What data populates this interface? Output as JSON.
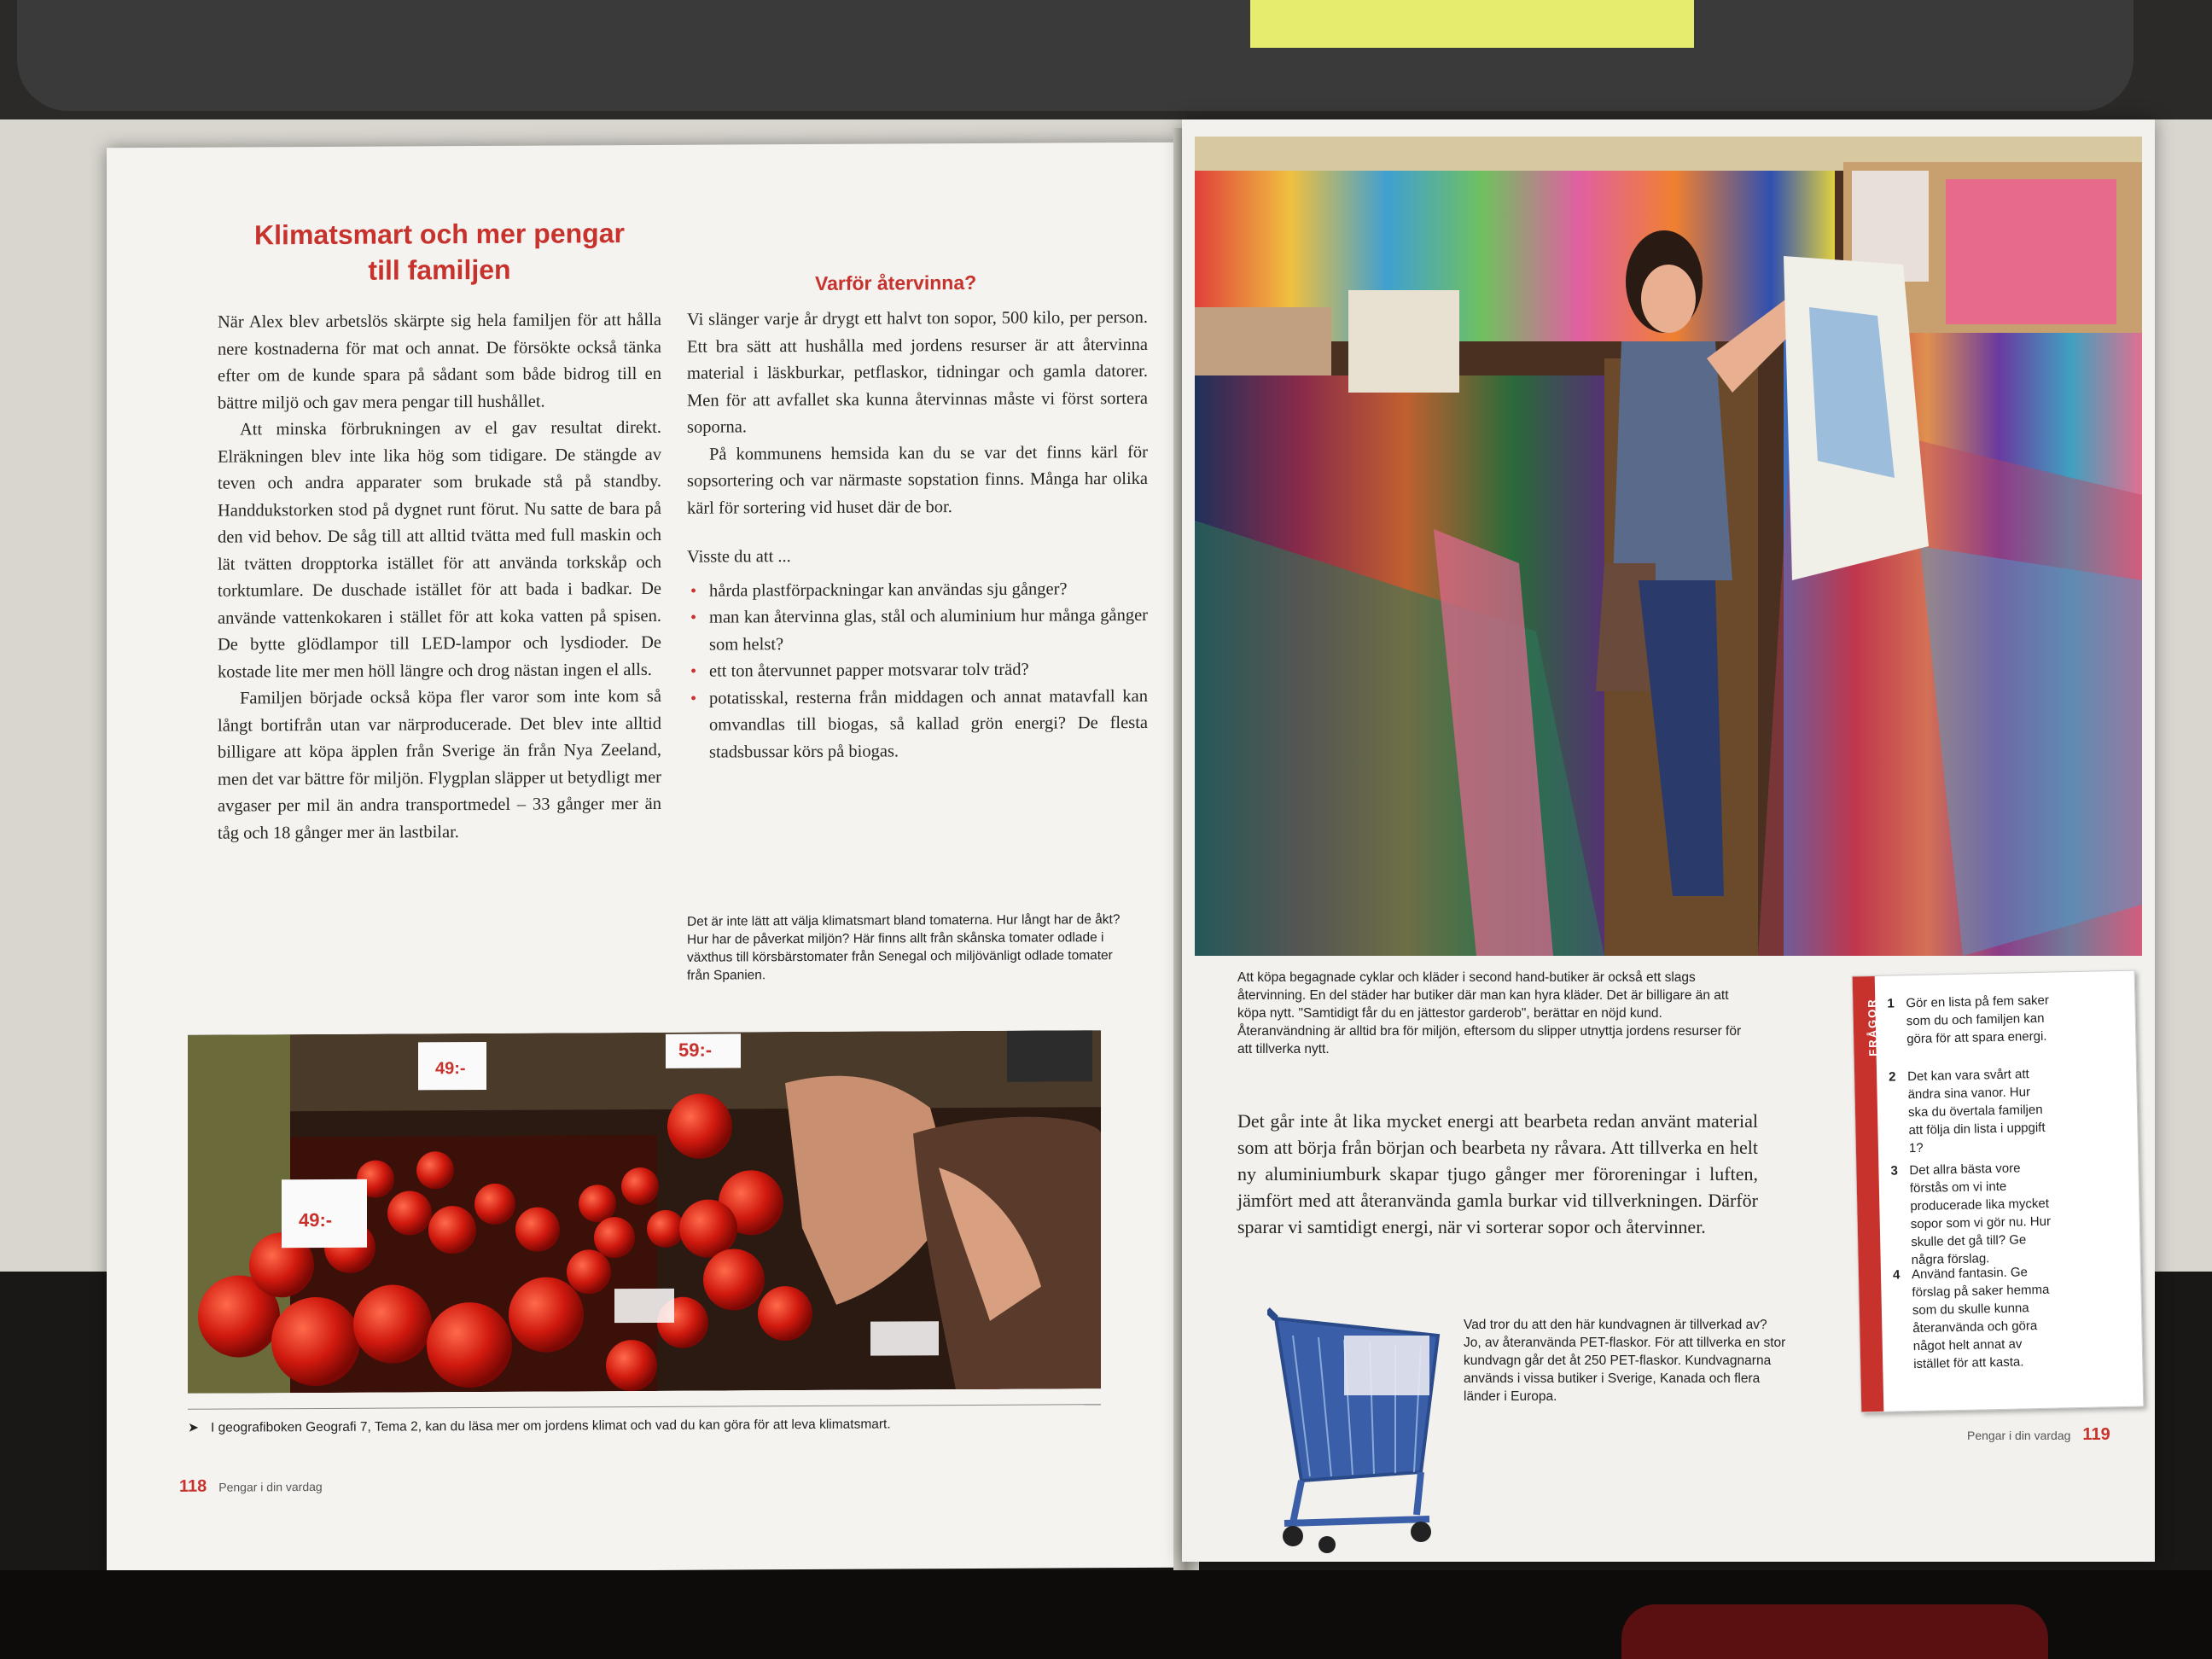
{
  "colors": {
    "accent": "#c8322d"
  },
  "left": {
    "title": "Klimatsmart och mer pengar till familjen",
    "col1": [
      "När Alex blev arbetslös skärpte sig hela familjen för att hålla nere kostnaderna för mat och annat. De försökte också tänka efter om de kunde spara på sådant som både bidrog till en bättre miljö och gav mera pengar till hushållet.",
      "Att minska förbrukningen av el gav resultat direkt. Elräkningen blev inte lika hög som tidigare. De stängde av teven och andra apparater som brukade stå på standby. Handdukstorken stod på dygnet runt förut. Nu satte de bara på den vid behov. De såg till att alltid tvätta med full maskin och lät tvätten dropptorka istället för att använda torkskåp och torktumlare. De duschade istället för att bada i badkar. De använde vattenkokaren i stället för att koka vatten på spisen. De bytte glödlampor till LED-lampor och lysdioder. De kostade lite mer men höll längre och drog nästan ingen el alls.",
      "Familjen började också köpa fler varor som inte kom så långt bortifrån utan var närproducerade. Det blev inte alltid billigare att köpa äpplen från Sverige än från Nya Zeeland, men det var bättre för miljön. Flygplan släpper ut betydligt mer avgaser per mil än andra transportmedel – 33 gånger mer än tåg och 18 gånger mer än lastbilar."
    ],
    "subheading": "Varför återvinna?",
    "col2": [
      "Vi slänger varje år drygt ett halvt ton sopor, 500 kilo, per person. Ett bra sätt att hushålla med jordens resurser är att återvinna material i läskburkar, petflaskor, tidningar och gamla datorer. Men för att avfallet ska kunna återvinnas måste vi först sortera soporna.",
      "På kommunens hemsida kan du se var det finns kärl för sopsortering och var närmaste sopstation finns. Många har olika kärl för sortering vid huset där de bor."
    ],
    "did_you_know": "Visste du att ...",
    "bullets": [
      "hårda plastförpackningar kan användas sju gånger?",
      "man kan återvinna glas, stål och aluminium hur många gånger som helst?",
      "ett ton återvunnet papper motsvarar tolv träd?",
      "potatisskal, resterna från middagen och annat matavfall kan omvandlas till biogas, så kallad grön energi? De flesta stadsbussar körs på biogas."
    ],
    "tomato_caption": "Det är inte lätt att välja klimatsmart bland tomaterna. Hur långt har de åkt? Hur har de påverkat miljön? Här finns allt från skånska tomater odlade i växthus till körsbärstomater från Senegal och miljövänligt odlade tomater från Spanien.",
    "price_tags": [
      "59:-",
      "49:-",
      "49:-"
    ],
    "footnote": "I geografiboken Geografi 7, Tema 2, kan du läsa mer om jordens klimat och vad du kan göra för att leva klimatsmart.",
    "page_number": "118",
    "page_label": "Pengar i din vardag"
  },
  "right": {
    "shop_caption": "Att köpa begagnade cyklar och kläder i second hand-butiker är också ett slags återvinning. En del städer har butiker där man kan hyra kläder. Det är billigare än att köpa nytt. \"Samtidigt får du en jättestor garderob\", berättar en nöjd kund. Återanvändning är alltid bra för miljön, eftersom du slipper utnyttja jordens resurser för att tillverka nytt.",
    "body": "Det går inte åt lika mycket energi att bearbeta redan använt material som att börja från början och bearbeta ny råvara. Att tillverka en helt ny aluminiumburk skapar tjugo gånger mer föroreningar i luften, jämfört med att återanvända gamla burkar vid tillverkningen. Därför sparar vi samtidigt energi, när vi sorterar sopor och återvinner.",
    "cart_caption": "Vad tror du att den här kundvagnen är tillverkad av? Jo, av återanvända PET-flaskor. För att tillverka en stor kundvagn går det åt 250 PET-flaskor. Kundvagnarna används i vissa butiker i Sverige, Kanada och flera länder i Europa.",
    "questions_label": "FRÅGOR",
    "questions": [
      {
        "num": "1",
        "text": "Gör en lista på fem saker som du och familjen kan göra för att spara energi."
      },
      {
        "num": "2",
        "text": "Det kan vara svårt att ändra sina vanor. Hur ska du övertala familjen att följa din lista i uppgift 1?"
      },
      {
        "num": "3",
        "text": "Det allra bästa vore förstås om vi inte producerade lika mycket sopor som vi gör nu. Hur skulle det gå till? Ge några förslag."
      },
      {
        "num": "4",
        "text": "Använd fantasin. Ge förslag på saker hemma som du skulle kunna återanvända och göra något helt annat av istället för att kasta."
      }
    ],
    "page_label": "Pengar i din vardag",
    "page_number": "119"
  }
}
